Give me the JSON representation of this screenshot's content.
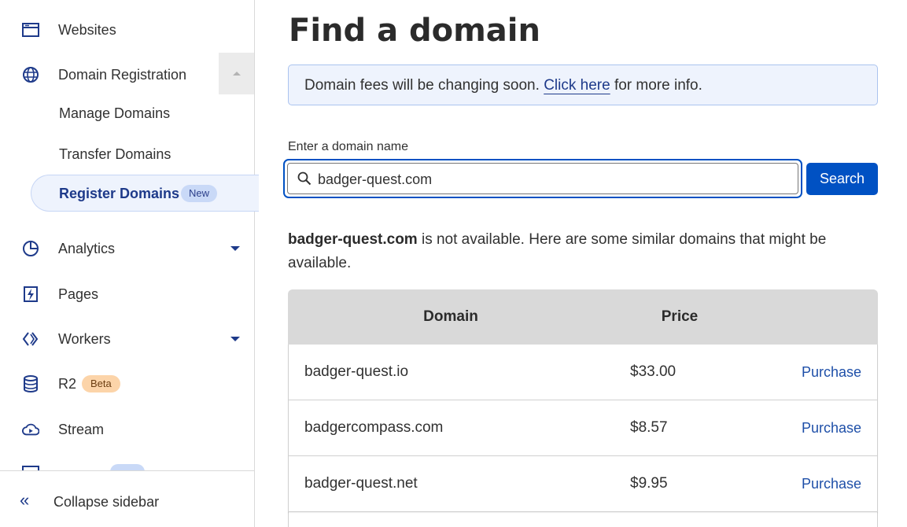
{
  "sidebar": {
    "websites": "Websites",
    "domain_registration": "Domain Registration",
    "manage_domains": "Manage Domains",
    "transfer_domains": "Transfer Domains",
    "register_domains": "Register Domains",
    "register_badge": "New",
    "analytics": "Analytics",
    "pages": "Pages",
    "workers": "Workers",
    "r2": "R2",
    "r2_badge": "Beta",
    "stream": "Stream",
    "collapse": "Collapse sidebar"
  },
  "main": {
    "title": "Find a domain",
    "banner": {
      "before": "Domain fees will be changing soon. ",
      "link": "Click here",
      "after": " for more info."
    },
    "search": {
      "label": "Enter a domain name",
      "value": "badger-quest.com",
      "button": "Search"
    },
    "result": {
      "domain": "badger-quest.com",
      "message": " is not available. Here are some similar domains that might be available."
    },
    "table": {
      "headers": [
        "Domain",
        "Price"
      ],
      "rows": [
        {
          "domain": "badger-quest.io",
          "price": "$33.00",
          "action": "Purchase"
        },
        {
          "domain": "badgercompass.com",
          "price": "$8.57",
          "action": "Purchase"
        },
        {
          "domain": "badger-quest.net",
          "price": "$9.95",
          "action": "Purchase"
        }
      ]
    }
  },
  "colors": {
    "accent": "#0051c3",
    "nav_icon": "#1e3a8a",
    "banner_bg": "#eef3fd",
    "table_header_bg": "#d9d9d9"
  }
}
